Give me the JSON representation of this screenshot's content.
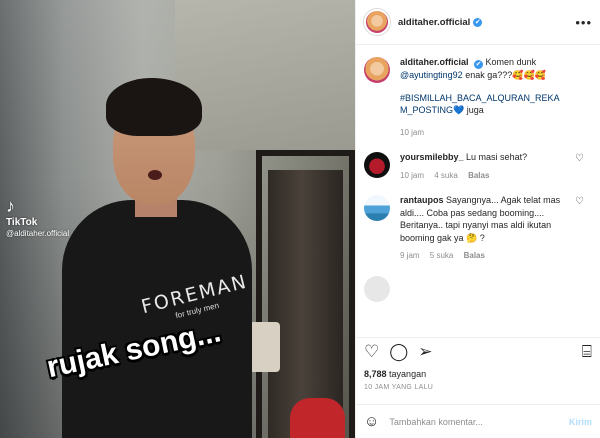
{
  "video": {
    "tiktok_brand": "TikTok",
    "tiktok_handle": "@alditaher.official",
    "shirt_text": "FOREMAN",
    "shirt_subtext": "for truly men",
    "caption": "rujak song..."
  },
  "header": {
    "username": "alditaher.official",
    "verified_mark": "✔",
    "more_glyph": "•••"
  },
  "post": {
    "username": "alditaher.official",
    "text_before": " Komen dunk ",
    "mention": "@ayutingting92",
    "text_after": " enak ga???🥰🥰🥰",
    "hashtag": "#BISMILLAH_BACA_ALQURAN_REKAM_POSTING",
    "suffix": "💙 juga",
    "time": "10 jam"
  },
  "comments": [
    {
      "username": "yoursmilebby_",
      "text": "Lu masi sehat?",
      "time": "10 jam",
      "likes": "4 suka",
      "reply": "Balas"
    },
    {
      "username": "rantaupos",
      "text": "Sayangnya... Agak telat mas aldi.... Coba pas sedang booming.... Beritanya.. tapi nyanyi mas aldi ikutan booming gak ya 🤔 ?",
      "time": "9 jam",
      "likes": "5 suka",
      "reply": "Balas"
    }
  ],
  "actions": {
    "views_count": "8,788",
    "views_label": "tayangan",
    "posted_ago": "10 JAM YANG LALU"
  },
  "add_comment": {
    "placeholder": "Tambahkan komentar...",
    "post_label": "Kirim"
  },
  "icons": {
    "verified": "verified-badge-icon",
    "heart": "heart-icon",
    "comment": "comment-icon",
    "share": "share-icon",
    "save": "bookmark-icon",
    "emoji": "emoji-icon"
  }
}
